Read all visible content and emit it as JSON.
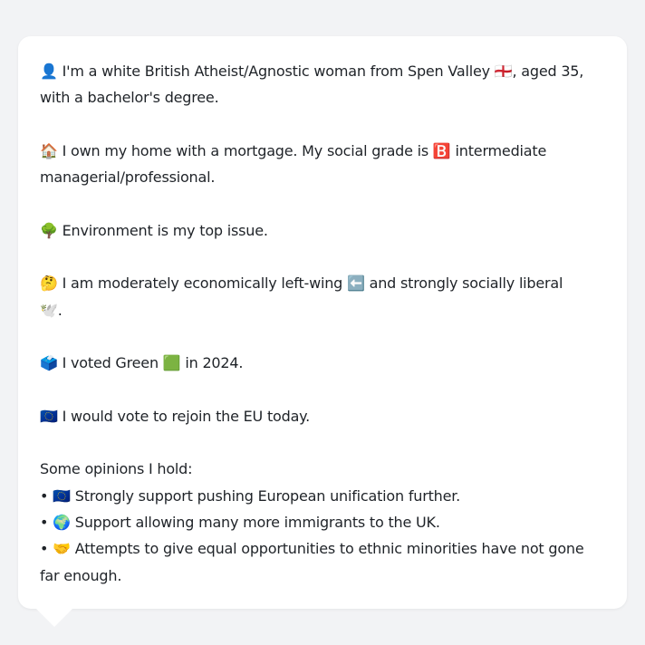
{
  "paragraphs": [
    {
      "lines": [
        "👤 I'm a white British Atheist/Agnostic woman from Spen Valley 🏴󠁧󠁢󠁥󠁮󠁧󠁿, aged 35,",
        "with a bachelor's degree."
      ]
    },
    {
      "lines": [
        "🏠 I own my home with a mortgage. My social grade is 🅱️ intermediate",
        "managerial/professional."
      ]
    },
    {
      "lines": [
        "🌳 Environment is my top issue."
      ]
    },
    {
      "lines": [
        "🤔 I am moderately economically left-wing ⬅️ and strongly socially liberal",
        "🕊️."
      ]
    },
    {
      "lines": [
        "🗳️ I voted Green 🟩 in 2024."
      ]
    },
    {
      "lines": [
        "🇪🇺 I would vote to rejoin the EU today."
      ]
    },
    {
      "lines": [
        "Some opinions I hold:",
        "• 🇪🇺 Strongly support pushing European unification further.",
        "• 🌍 Support allowing many more immigrants to the UK.",
        "• 🤝 Attempts to give equal opportunities to ethnic minorities have not gone",
        "far enough."
      ]
    }
  ]
}
